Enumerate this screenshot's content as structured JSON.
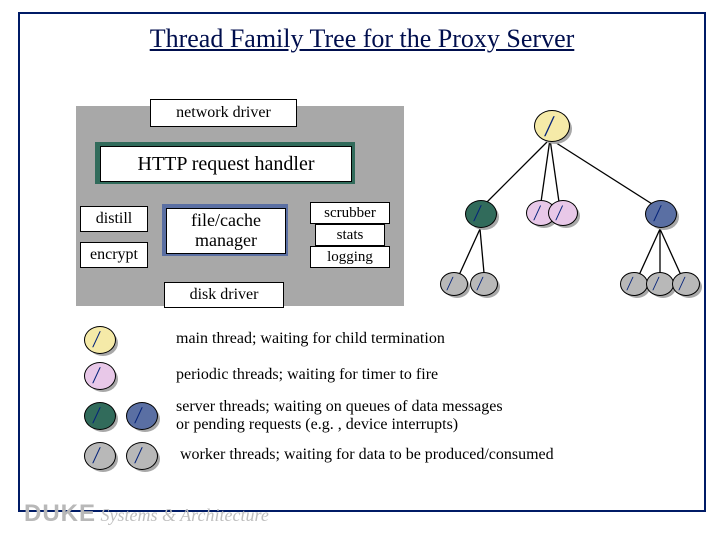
{
  "title": "Thread Family Tree for the Proxy Server",
  "arch": {
    "net_driver": "network driver",
    "http_handler": "HTTP request handler",
    "distill": "distill",
    "encrypt": "encrypt",
    "file_cache": "file/cache manager",
    "scrubber": "scrubber",
    "stats": "stats",
    "logging": "logging",
    "disk_driver": "disk driver"
  },
  "legend": {
    "main": "main thread; waiting for child termination",
    "periodic": "periodic threads; waiting for timer to fire",
    "server_l1": "server threads; waiting on queues of data messages",
    "server_l2": "or pending requests (e.g. , device interrupts)",
    "worker": "worker threads; waiting for data to be produced/consumed"
  },
  "colors": {
    "main": "#f5eaa8",
    "periodic": "#e8c8e8",
    "server_a": "#316b5b",
    "server_b": "#5a6fa3",
    "worker": "#b8b8b8",
    "spark": "#05237a"
  },
  "footer": {
    "duke": "DUKE",
    "sa": "Systems & Architecture"
  }
}
